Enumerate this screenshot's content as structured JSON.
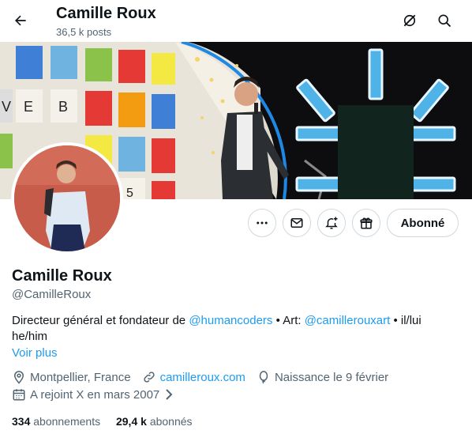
{
  "header": {
    "name": "Camille Roux",
    "posts_count": "36,5 k posts",
    "icons": [
      "back-arrow-icon",
      "grok-icon",
      "search-icon"
    ]
  },
  "profile": {
    "name": "Camille Roux",
    "handle": "@CamilleRoux",
    "follow_label": "Abonné",
    "action_icons": [
      "more-icon",
      "message-icon",
      "notification-add-icon",
      "subscribe-gift-icon"
    ],
    "bio": {
      "part1": "Directeur général et fondateur de ",
      "mention1": "@humancoders",
      "part2": " • Art: ",
      "mention2": "@camillerouxart",
      "part3": " • il/lui he/him"
    },
    "see_more": "Voir plus",
    "location": "Montpellier, France",
    "website": "camilleroux.com",
    "birthday": "Naissance le 9 février",
    "joined": "A rejoint X en mars 2007",
    "following_count": "334",
    "following_label": "abonnements",
    "followers_count": "29,4 k",
    "followers_label": "abonnés"
  },
  "colors": {
    "accent": "#1d9bf0",
    "text": "#0f1419",
    "secondary": "#536471",
    "border": "#cfd9de"
  }
}
